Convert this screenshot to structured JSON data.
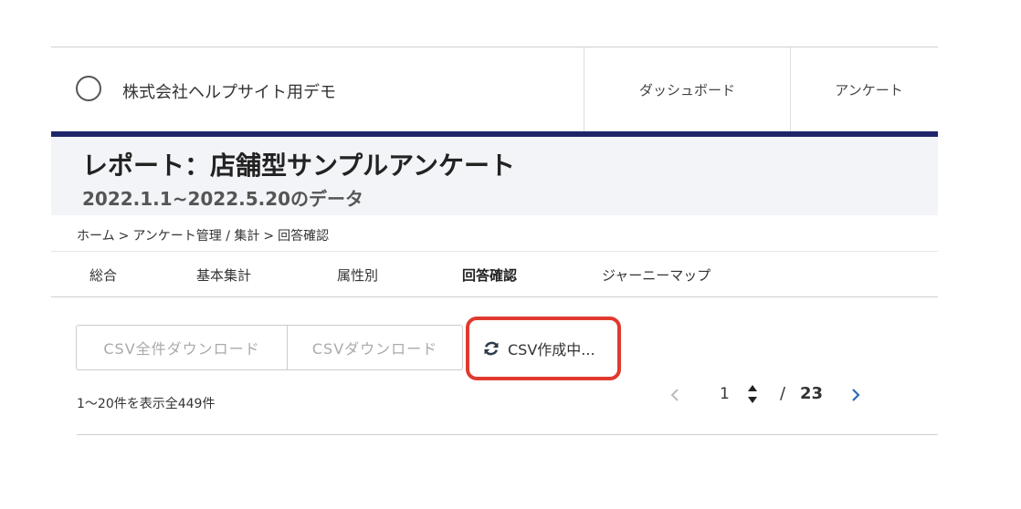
{
  "header": {
    "company_name": "株式会社ヘルプサイト用デモ",
    "nav": {
      "dashboard": "ダッシュボード",
      "survey": "アンケート"
    }
  },
  "report": {
    "title": "レポート：店舗型サンプルアンケート",
    "period": "2022.1.1~2022.5.20のデータ"
  },
  "breadcrumb": {
    "home": "ホーム",
    "separator": ">",
    "survey_management": "アンケート管理 / 集計",
    "answer_check": "回答確認"
  },
  "tabs": [
    {
      "label": "総合"
    },
    {
      "label": "基本集計"
    },
    {
      "label": "属性別"
    },
    {
      "label": "回答確認",
      "active": true
    },
    {
      "label": "ジャーニーマップ"
    }
  ],
  "csv": {
    "all_download": "CSV全件ダウンロード",
    "download": "CSVダウンロード",
    "creating": "CSV作成中..."
  },
  "results": {
    "count_text": "1〜20件を表示全449件"
  },
  "pagination": {
    "current_page": "1",
    "separator": "/",
    "total_pages": "23"
  },
  "colors": {
    "brand_bar": "#1f2569",
    "highlight": "#e03a2f",
    "pager_accent": "#2a6db0"
  },
  "icons": {
    "logo": "circle-logo-icon",
    "refresh": "refresh-icon",
    "prev": "chevron-left-icon",
    "next": "chevron-right-icon",
    "stepper": "up-down-stepper-icon"
  }
}
